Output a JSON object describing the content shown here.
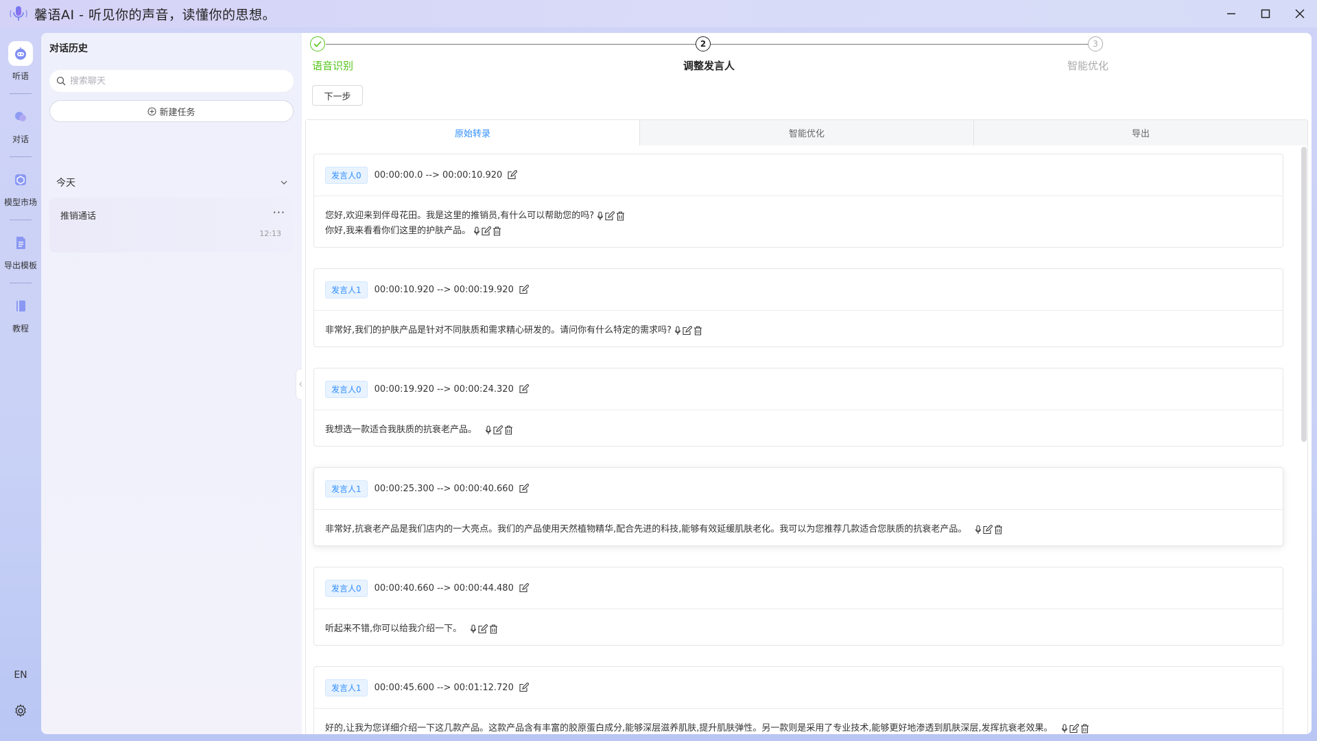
{
  "window": {
    "title": "馨语AI - 听见你的声音，读懂你的思想。"
  },
  "nav": {
    "items": [
      {
        "label": "听语",
        "icon": "robot-icon"
      },
      {
        "label": "对话",
        "icon": "chat-icon"
      },
      {
        "label": "模型市场",
        "icon": "cube-icon"
      },
      {
        "label": "导出模板",
        "icon": "document-icon"
      },
      {
        "label": "教程",
        "icon": "book-icon"
      }
    ],
    "lang": "EN"
  },
  "history": {
    "title": "对话历史",
    "search_placeholder": "搜索聊天",
    "new_task_label": "新建任务",
    "group_label": "今天",
    "items": [
      {
        "title": "推销通话",
        "time": "12:13"
      }
    ]
  },
  "steps": [
    {
      "label": "语音识别",
      "number": "1",
      "status": "done"
    },
    {
      "label": "调整发言人",
      "number": "2",
      "status": "current"
    },
    {
      "label": "智能优化",
      "number": "3",
      "status": "pending"
    }
  ],
  "next_label": "下一步",
  "tabs": [
    {
      "label": "原始转录",
      "active": true
    },
    {
      "label": "智能优化",
      "active": false
    },
    {
      "label": "导出",
      "active": false
    }
  ],
  "segments": [
    {
      "speaker": "发言人0",
      "time": "00:00:00.0 --> 00:00:10.920",
      "lines": [
        "您好,欢迎来到伴母花田。我是这里的推销员,有什么可以帮助您的吗?",
        "你好,我来看看你们这里的护肤产品。"
      ]
    },
    {
      "speaker": "发言人1",
      "time": "00:00:10.920 --> 00:00:19.920",
      "lines": [
        "非常好,我们的护肤产品是针对不同肤质和需求精心研发的。请问你有什么特定的需求吗?"
      ]
    },
    {
      "speaker": "发言人0",
      "time": "00:00:19.920 --> 00:00:24.320",
      "lines": [
        "我想选一款适合我肤质的抗衰老产品。"
      ]
    },
    {
      "speaker": "发言人1",
      "time": "00:00:25.300 --> 00:00:40.660",
      "lines": [
        "非常好,抗衰老产品是我们店内的一大亮点。我们的产品使用天然植物精华,配合先进的科技,能够有效延缓肌肤老化。我可以为您推荐几款适合您肤质的抗衰老产品。"
      ]
    },
    {
      "speaker": "发言人0",
      "time": "00:00:40.660 --> 00:00:44.480",
      "lines": [
        "听起来不错,你可以给我介绍一下。"
      ]
    },
    {
      "speaker": "发言人1",
      "time": "00:00:45.600 --> 00:01:12.720",
      "lines": [
        "好的,让我为您详细介绍一下这几款产品。这款产品含有丰富的胶原蛋白成分,能够深层滋养肌肤,提升肌肤弹性。另一款则是采用了专业技术,能够更好地渗透到肌肤深层,发挥抗衰老效果。"
      ]
    }
  ],
  "colors": {
    "accent": "#2f8dff",
    "done": "#52c41a",
    "tag_bg": "#e8f3ff"
  }
}
